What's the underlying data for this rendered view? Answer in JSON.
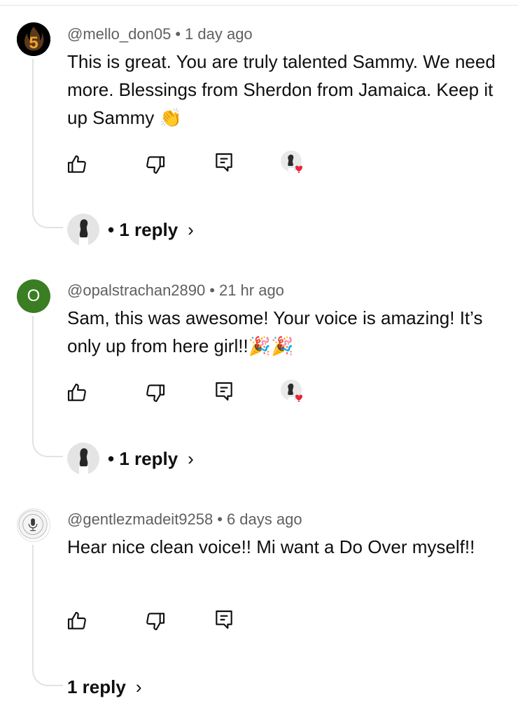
{
  "comments": [
    {
      "handle": "@mello_don05",
      "time": "1 day ago",
      "body": "This is great. You are truly talented Sammy. We need more. Blessings from Sherdon from Jamaica. Keep it up Sammy",
      "emoji": "👏",
      "avatar": {
        "type": "logo",
        "letter": "5",
        "bg": "#000000",
        "fg": "#f2a32b"
      },
      "hearted": true,
      "replies": "1 reply",
      "reply_prefix": "•"
    },
    {
      "handle": "@opalstrachan2890",
      "time": "21 hr ago",
      "body": "Sam, this was awesome! Your voice is amazing! It’s only up from here girl!!",
      "emoji": "🎉🎉",
      "avatar": {
        "type": "letter",
        "letter": "O",
        "bg": "#3a7d22",
        "fg": "#ffffff"
      },
      "hearted": true,
      "replies": "1 reply",
      "reply_prefix": "•"
    },
    {
      "handle": "@gentlezmadeit9258",
      "time": "6 days ago",
      "body": "Hear nice clean voice!! Mi want a Do Over myself!!",
      "emoji": "",
      "avatar": {
        "type": "badge",
        "bg": "#ffffff"
      },
      "hearted": false,
      "replies": "1 reply",
      "reply_prefix": ""
    }
  ],
  "meta_separator": "•",
  "colors": {
    "heart": "#e8263a",
    "meta": "#606060",
    "text": "#0f0f0f",
    "thread": "#e2e2e2"
  },
  "icons": [
    "thumbs-up-icon",
    "thumbs-down-icon",
    "reply-icon",
    "creator-heart-icon",
    "chevron-right-icon"
  ]
}
